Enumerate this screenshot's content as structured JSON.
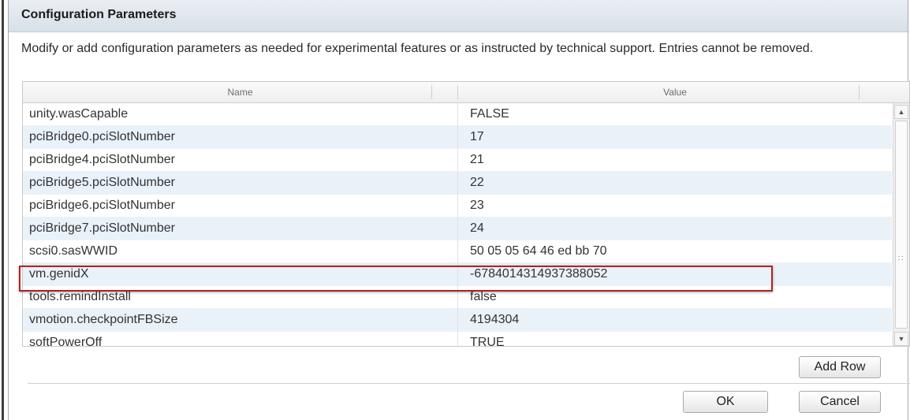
{
  "dialog": {
    "title": "Configuration Parameters",
    "description": "Modify or add configuration parameters as needed for experimental features or as instructed by technical support. Entries cannot be removed."
  },
  "table": {
    "columns": [
      "Name",
      "Value"
    ],
    "rows": [
      {
        "name": "unity.wasCapable",
        "value": "FALSE"
      },
      {
        "name": "pciBridge0.pciSlotNumber",
        "value": "17"
      },
      {
        "name": "pciBridge4.pciSlotNumber",
        "value": "21"
      },
      {
        "name": "pciBridge5.pciSlotNumber",
        "value": "22"
      },
      {
        "name": "pciBridge6.pciSlotNumber",
        "value": "23"
      },
      {
        "name": "pciBridge7.pciSlotNumber",
        "value": "24"
      },
      {
        "name": "scsi0.sasWWID",
        "value": "50 05 05 64 46 ed bb 70"
      },
      {
        "name": "vm.genidX",
        "value": "-6784014314937388052"
      },
      {
        "name": "tools.remindInstall",
        "value": "false"
      },
      {
        "name": "vmotion.checkpointFBSize",
        "value": "4194304"
      },
      {
        "name": "softPowerOff",
        "value": "TRUE"
      }
    ],
    "highlighted_row": "vm.genidX"
  },
  "buttons": {
    "add_row": "Add Row",
    "ok": "OK",
    "cancel": "Cancel"
  },
  "colors": {
    "highlight_border": "#b22222",
    "alt_row": "#e9f1f9"
  }
}
